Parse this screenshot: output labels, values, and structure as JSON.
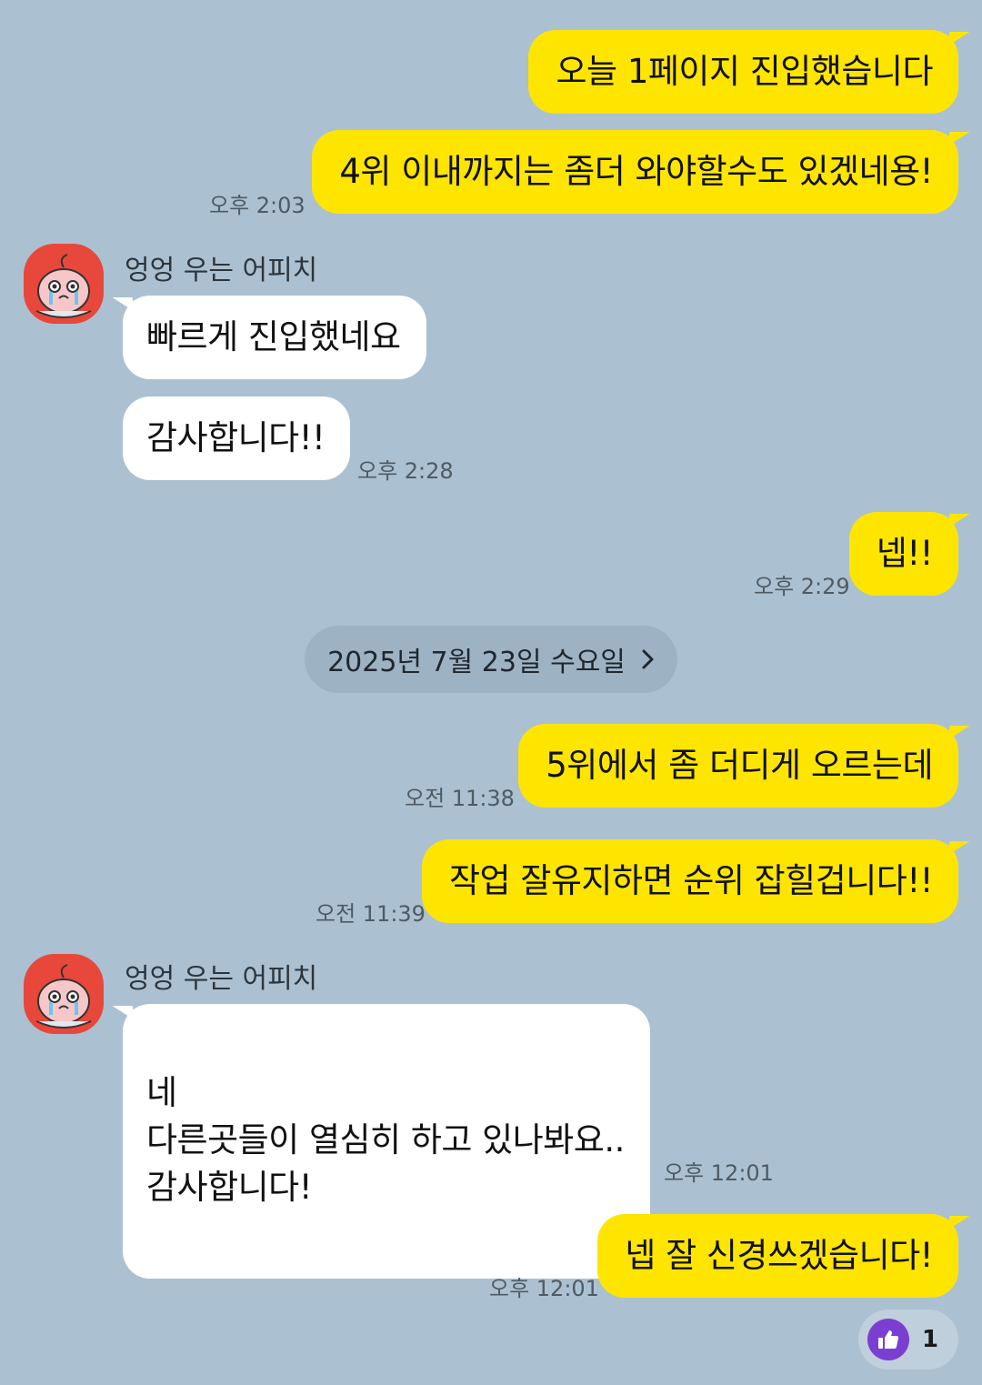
{
  "messages": {
    "m1": {
      "text": "오늘 1페이지 진입했습니다"
    },
    "m2": {
      "text": "4위 이내까지는 좀더 와야할수도 있겠네용!",
      "time": "오후 2:03"
    },
    "m3": {
      "sender": "엉엉 우는 어피치",
      "text": "빠르게 진입했네요"
    },
    "m4": {
      "text": "감사합니다!!",
      "time": "오후 2:28"
    },
    "m5": {
      "text": "넵!!",
      "time": "오후 2:29"
    },
    "m6": {
      "text": "5위에서 좀 더디게 오르는데",
      "time": "오전 11:38"
    },
    "m7": {
      "text": "작업 잘유지하면 순위 잡힐겁니다!!",
      "time": "오전 11:39"
    },
    "m8": {
      "sender": "엉엉 우는 어피치",
      "text": "네\n다른곳들이 열심히 하고 있나봐요..\n감사합니다!",
      "time": "오후 12:01"
    },
    "m9": {
      "text": "넵 잘 신경쓰겠습니다!",
      "time": "오후 12:01"
    }
  },
  "date_divider": {
    "label": "2025년 7월 23일 수요일",
    "icon": "chevron-right-icon"
  },
  "reaction": {
    "icon": "thumbs-up-icon",
    "count": "1",
    "color": "#7a3fd1"
  },
  "colors": {
    "background": "#abc1d1",
    "my_bubble": "#fee500",
    "their_bubble": "#ffffff",
    "avatar_bg": "#e8473b"
  }
}
